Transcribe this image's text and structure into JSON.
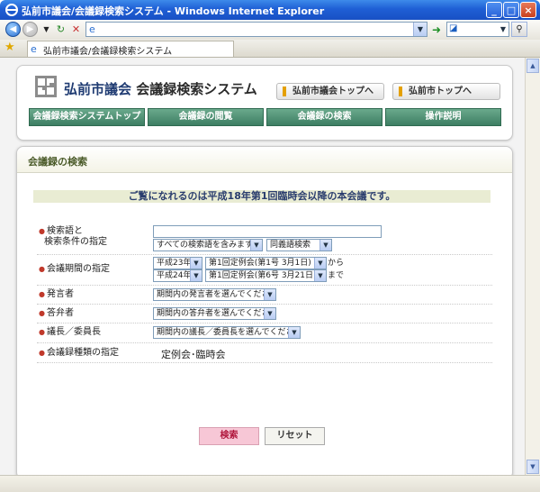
{
  "window": {
    "title": "弘前市議会/会議録検索システム - Windows Internet Explorer",
    "minimize": "_",
    "maximize": "□",
    "close": "×"
  },
  "browser": {
    "address_icon": "e",
    "tab_title": "弘前市議会/会議録検索システム",
    "back_icon": "back-arrow-icon",
    "forward_icon": "forward-arrow-icon",
    "refresh_icon": "refresh-icon",
    "stop_icon": "stop-icon",
    "go_icon": "go-arrow-icon",
    "search_icon": "magnifier-icon"
  },
  "header": {
    "site_city": "弘前市議会",
    "site_system": "会議録検索システム",
    "links": [
      "弘前市議会トップへ",
      "弘前市トップへ"
    ],
    "nav_tabs": [
      "会議録検索システムトップ",
      "会議録の閲覧",
      "会議録の検索",
      "操作説明"
    ]
  },
  "section": {
    "title": "会議録の検索",
    "notice": "ご覧になれるのは平成18年第1回臨時会以降の本会議です。"
  },
  "form": {
    "keyword_label_1": "検索語と",
    "keyword_label_2": "検索条件の指定",
    "keyword_value": "",
    "keyword_mode": "すべての検索語を含みます",
    "synonym_mode": "同義語検索",
    "period_label": "会議期間の指定",
    "from_year": "平成23年",
    "from_session": "第1回定例会(第1号 3月1日)",
    "from_suffix": "から",
    "to_year": "平成24年",
    "to_session": "第1回定例会(第6号 3月21日)",
    "to_suffix": "まで",
    "speaker_label": "発言者",
    "speaker_value": "期間内の発言者を選んでください",
    "answerer_label": "答弁者",
    "answerer_value": "期間内の答弁者を選んでください",
    "chair_label": "議長／委員長",
    "chair_value": "期間内の議長／委員長を選んでください",
    "type_label": "会議録種類の指定",
    "type_value": "定例会･臨時会",
    "search_button": "検索",
    "reset_button": "リセット"
  }
}
